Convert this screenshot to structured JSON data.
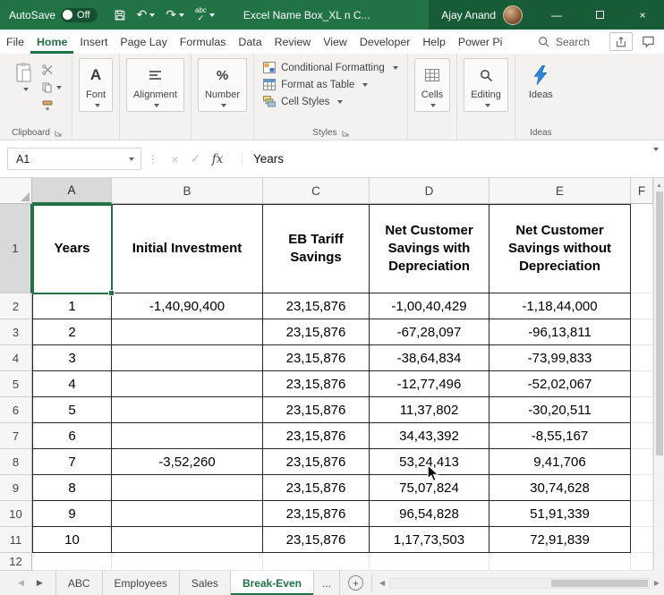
{
  "colors": {
    "excel_green": "#217346",
    "title_dark_green": "#185c37",
    "ideas_blue": "#2e86de"
  },
  "title_bar": {
    "autosave_label": "AutoSave",
    "autosave_state": "Off",
    "document_title": "Excel Name Box_XL n C...",
    "user_name": "Ajay Anand"
  },
  "ribbon_tabs": {
    "items": [
      "File",
      "Home",
      "Insert",
      "Page Lay",
      "Formulas",
      "Data",
      "Review",
      "View",
      "Developer",
      "Help",
      "Power Pi"
    ],
    "active": "Home",
    "search_label": "Search"
  },
  "ribbon": {
    "font_label": "Font",
    "alignment_label": "Alignment",
    "number_label": "Number",
    "conditional_formatting_label": "Conditional Formatting",
    "format_as_table_label": "Format as Table",
    "cell_styles_label": "Cell Styles",
    "cells_label": "Cells",
    "editing_label": "Editing",
    "ideas_label": "Ideas",
    "group_clipboard": "Clipboard",
    "group_styles": "Styles",
    "group_ideas": "Ideas"
  },
  "formula_bar": {
    "name_box": "A1",
    "fx_label": "fx",
    "value": "Years"
  },
  "grid": {
    "column_headers": [
      "A",
      "B",
      "C",
      "D",
      "E",
      "F"
    ],
    "selected_cell": "A1",
    "header_row_number": "1",
    "header_row": [
      "Years",
      "Initial Investment",
      "EB Tariff Savings",
      "Net Customer Savings with Depreciation",
      "Net Customer Savings without Depreciation"
    ],
    "rows": [
      {
        "n": "2",
        "cells": [
          "1",
          "-1,40,90,400",
          "23,15,876",
          "-1,00,40,429",
          "-1,18,44,000"
        ]
      },
      {
        "n": "3",
        "cells": [
          "2",
          "",
          "23,15,876",
          "-67,28,097",
          "-96,13,811"
        ]
      },
      {
        "n": "4",
        "cells": [
          "3",
          "",
          "23,15,876",
          "-38,64,834",
          "-73,99,833"
        ]
      },
      {
        "n": "5",
        "cells": [
          "4",
          "",
          "23,15,876",
          "-12,77,496",
          "-52,02,067"
        ]
      },
      {
        "n": "6",
        "cells": [
          "5",
          "",
          "23,15,876",
          "11,37,802",
          "-30,20,511"
        ]
      },
      {
        "n": "7",
        "cells": [
          "6",
          "",
          "23,15,876",
          "34,43,392",
          "-8,55,167"
        ]
      },
      {
        "n": "8",
        "cells": [
          "7",
          "-3,52,260",
          "23,15,876",
          "53,24,413",
          "9,41,706"
        ]
      },
      {
        "n": "9",
        "cells": [
          "8",
          "",
          "23,15,876",
          "75,07,824",
          "30,74,628"
        ]
      },
      {
        "n": "10",
        "cells": [
          "9",
          "",
          "23,15,876",
          "96,54,828",
          "51,91,339"
        ]
      },
      {
        "n": "11",
        "cells": [
          "10",
          "",
          "23,15,876",
          "1,17,73,503",
          "72,91,839"
        ]
      }
    ],
    "partial_row": "12"
  },
  "sheet_bar": {
    "tabs": [
      "ABC",
      "Employees",
      "Sales",
      "Break-Even"
    ],
    "active": "Break-Even",
    "overflow": "..."
  }
}
